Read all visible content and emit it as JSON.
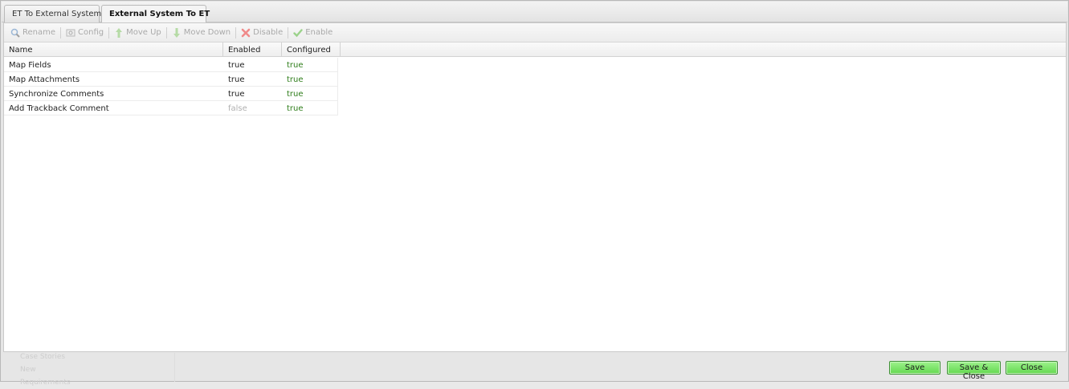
{
  "tabs": [
    {
      "label": "ET To External System"
    },
    {
      "label": "External System To ET"
    }
  ],
  "toolbar": {
    "rename": "Rename",
    "config": "Config",
    "move_up": "Move Up",
    "move_down": "Move Down",
    "disable": "Disable",
    "enable": "Enable"
  },
  "grid": {
    "columns": [
      "Name",
      "Enabled",
      "Configured"
    ],
    "rows": [
      {
        "name": "Map Fields",
        "enabled": "true",
        "configured": "true"
      },
      {
        "name": "Map Attachments",
        "enabled": "true",
        "configured": "true"
      },
      {
        "name": "Synchronize Comments",
        "enabled": "true",
        "configured": "true"
      },
      {
        "name": "Add Trackback Comment",
        "enabled": "false",
        "configured": "true"
      }
    ]
  },
  "background_ghost": [
    "Case Stories",
    "New",
    "Requirements"
  ],
  "footer": {
    "save": "Save",
    "save_close": "Save & Close",
    "close": "Close"
  },
  "colors": {
    "configured_text": "#2e7d1a",
    "disabled_text": "#b0b0b0",
    "button_green": "#63d84f"
  }
}
